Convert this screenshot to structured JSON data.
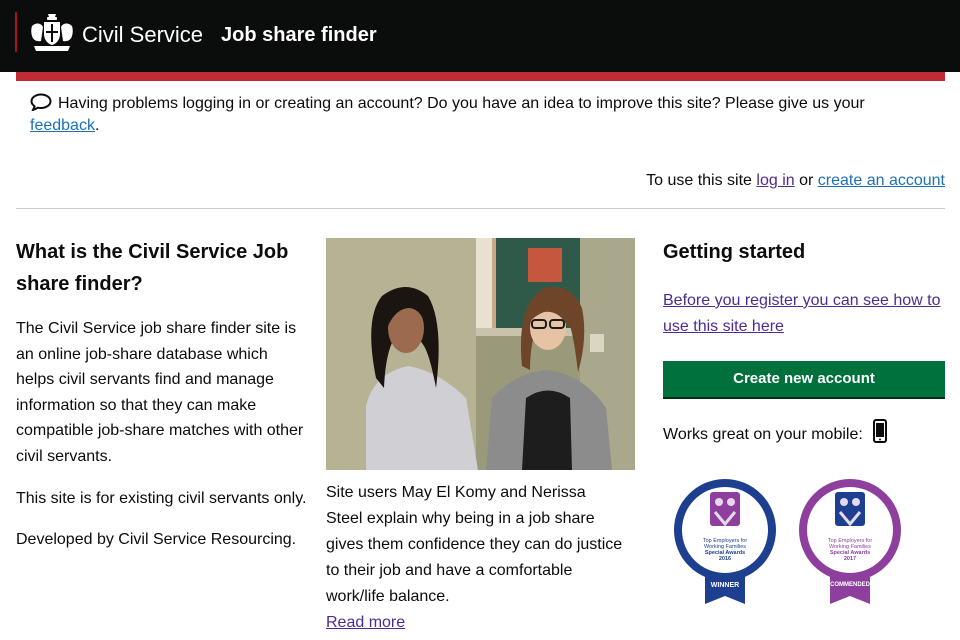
{
  "header": {
    "brand": "Civil Service",
    "service_name": "Job share finder"
  },
  "feedback": {
    "text": "Having problems logging in or creating an account? Do you have an idea to improve this site? Please give us your",
    "link": "feedback",
    "end": "."
  },
  "account": {
    "prefix": "To use this site",
    "login": "log in",
    "or": "or",
    "create": "create an account"
  },
  "about": {
    "heading": "What is the Civil Service Job share finder?",
    "p1": "The Civil Service job share finder site is an online job-share database which helps civil servants find and manage information so that they can make compatible job-share matches with other civil servants.",
    "p2": "This site is for existing civil servants only.",
    "p3": "Developed by Civil Service Resourcing."
  },
  "feature": {
    "caption": "Site users May El Komy and Nerissa Steel explain why being in a job share gives them confidence they can do justice to their job and have a comfortable work/life balance.",
    "read_more": "Read more"
  },
  "getting_started": {
    "heading": "Getting started",
    "guide_link": "Before you register you can see how to use this site here",
    "button": "Create new account",
    "mobile_text": "Works great on your mobile:"
  },
  "awards": [
    {
      "line1": "Top Employers for",
      "line2": "Working Families",
      "line3": "Special Awards",
      "year": "2016",
      "ribbon": "WINNER",
      "color": "#1d3f8f"
    },
    {
      "line1": "Top Employers for",
      "line2": "Working Families",
      "line3": "Special Awards",
      "year": "2017",
      "ribbon": "COMMENDED",
      "color": "#8e3f9e"
    }
  ],
  "colors": {
    "header_bg": "#0b0c0c",
    "accent_bar": "#c02c33",
    "link": "#1d70b8",
    "visited_link": "#4c2c92",
    "button": "#00703c"
  }
}
